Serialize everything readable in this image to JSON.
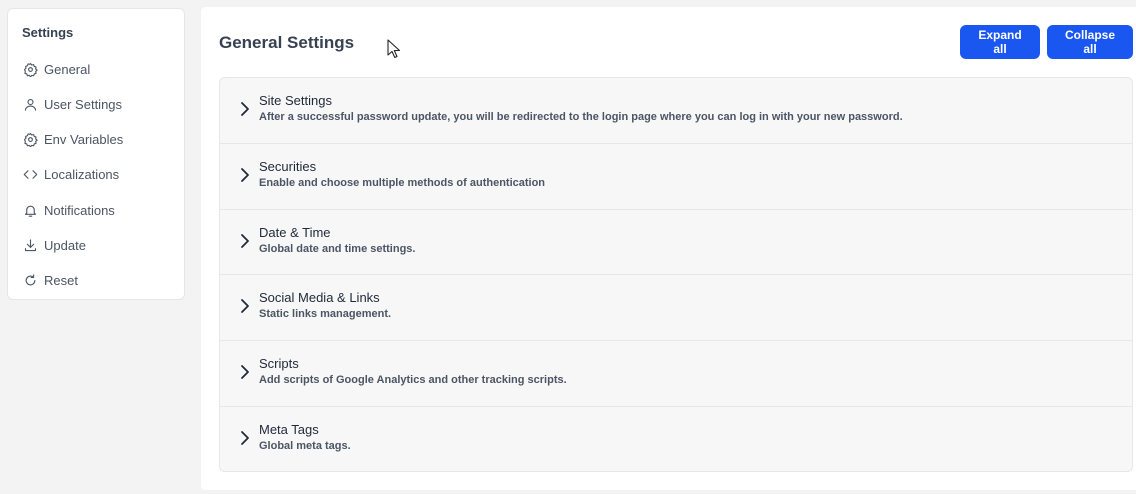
{
  "sidebar": {
    "title": "Settings",
    "items": [
      {
        "label": "General",
        "icon": "gear-icon"
      },
      {
        "label": "User Settings",
        "icon": "user-icon"
      },
      {
        "label": "Env Variables",
        "icon": "gear-icon"
      },
      {
        "label": "Localizations",
        "icon": "code-icon"
      },
      {
        "label": "Notifications",
        "icon": "bell-icon"
      },
      {
        "label": "Update",
        "icon": "download-icon"
      },
      {
        "label": "Reset",
        "icon": "refresh-icon"
      }
    ]
  },
  "main": {
    "title": "General Settings",
    "expand_label": "Expand all",
    "collapse_label": "Collapse all",
    "sections": [
      {
        "title": "Site Settings",
        "description": "After a successful password update, you will be redirected to the login page where you can log in with your new password."
      },
      {
        "title": "Securities",
        "description": "Enable and choose multiple methods of authentication"
      },
      {
        "title": "Date & Time",
        "description": "Global date and time settings."
      },
      {
        "title": "Social Media & Links",
        "description": "Static links management."
      },
      {
        "title": "Scripts",
        "description": "Add scripts of Google Analytics and other tracking scripts."
      },
      {
        "title": "Meta Tags",
        "description": "Global meta tags."
      }
    ]
  },
  "colors": {
    "accent": "#1a56f0",
    "background": "#f3f3f4",
    "panel": "#ffffff"
  }
}
